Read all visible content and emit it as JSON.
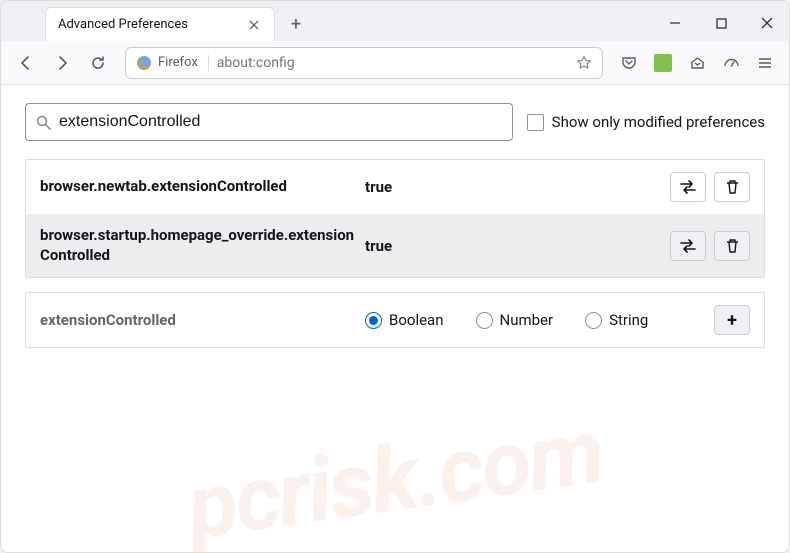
{
  "tab": {
    "title": "Advanced Preferences"
  },
  "urlbar": {
    "identity": "Firefox",
    "url": "about:config"
  },
  "search": {
    "value": "extensionControlled",
    "checkbox_label": "Show only modified preferences"
  },
  "prefs": [
    {
      "name": "browser.newtab.extensionControlled",
      "value": "true"
    },
    {
      "name": "browser.startup.homepage_override.extensionControlled",
      "value": "true"
    }
  ],
  "new_pref": {
    "name": "extensionControlled",
    "types": {
      "boolean": "Boolean",
      "number": "Number",
      "string": "String"
    }
  },
  "watermark": "pcrisk.com"
}
